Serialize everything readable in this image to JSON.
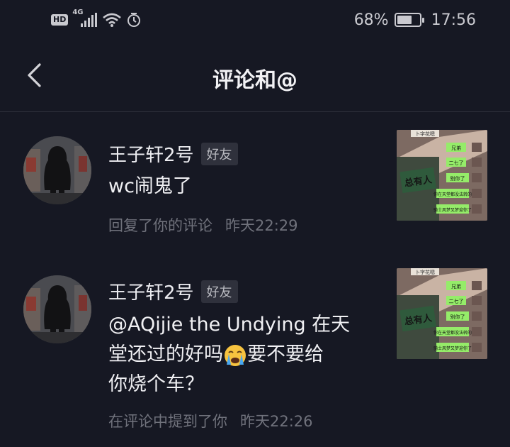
{
  "status_bar": {
    "hd": "HD",
    "network": "4G",
    "battery_text": "68%",
    "battery_level": 0.68,
    "time": "17:56"
  },
  "header": {
    "title": "评论和@"
  },
  "comments": [
    {
      "name": "王子轩2号",
      "tag": "好友",
      "text": "wc闹鬼了",
      "action": "回复了你的评论",
      "time": "昨天22:29"
    },
    {
      "name": "王子轩2号",
      "tag": "好友",
      "text_line1": "@AQijie the Undying 在天",
      "text_line2a": "堂还过的好吗",
      "text_line2b": "要不要给",
      "text_line3": "你烧个车？",
      "action": "在评论中提到了你",
      "time": "昨天22:26"
    }
  ],
  "thumbnail": {
    "header": "卜字花嗯",
    "sign": "总有人",
    "bubbles": [
      "兄弟",
      "二七了",
      "别你了",
      "你在天堂都没法转的",
      "骑士风梦又梦迎你了"
    ]
  },
  "colors": {
    "background": "#161823",
    "chat_bubble": "#95ec69"
  }
}
